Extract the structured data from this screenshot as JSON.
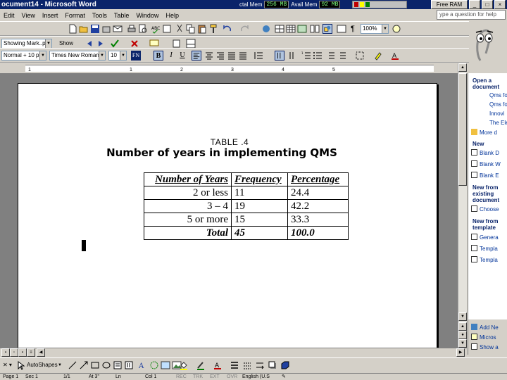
{
  "window": {
    "title": "ocument14 - Microsoft Word",
    "memory": {
      "total_label": "ctal Mem",
      "total_value": "256 MB",
      "avail_label": "Avail Mem",
      "avail_value": "92 MB"
    },
    "right_button": "Free RAM"
  },
  "menu": {
    "items": [
      "Edit",
      "View",
      "Insert",
      "Format",
      "Tools",
      "Table",
      "Window",
      "Help"
    ],
    "help_placeholder": "ype a question for help"
  },
  "toolbar_standard": {
    "zoom": "100%"
  },
  "toolbar_reviewing": {
    "display": "Showing Mark..p",
    "show": "Show"
  },
  "toolbar_formatting": {
    "style": "Normal + 10 pt",
    "font": "Times New Roman",
    "size": "10",
    "bold": "B",
    "italic": "I",
    "underline": "U"
  },
  "ruler_numbers": [
    "1",
    "1",
    "2",
    "3",
    "4",
    "5"
  ],
  "document": {
    "caption": "TABLE .4",
    "title": "Number of years in implementing QMS",
    "table": {
      "headers": [
        "Number of Years",
        "Frequency",
        "Percentage"
      ],
      "rows": [
        [
          "2 or less",
          "11",
          "24.4"
        ],
        [
          "3 – 4",
          "19",
          "42.2"
        ],
        [
          "5 or more",
          "15",
          "33.3"
        ]
      ],
      "total": [
        "Total",
        "45",
        "100.0"
      ]
    }
  },
  "task_pane": {
    "open_heading": "Open a document",
    "open_links": [
      "Qms fo",
      "Qms fo",
      "Innovi",
      "The Ele",
      "More d"
    ],
    "new_heading": "New",
    "new_links": [
      "Blank D",
      "Blank W",
      "Blank E"
    ],
    "existing_heading": "New from existing document",
    "existing_links": [
      "Choose"
    ],
    "template_heading": "New from template",
    "template_links": [
      "Genera",
      "Templa",
      "Templa"
    ],
    "bottom_links": [
      "Add Ne",
      "Micros",
      "Show a"
    ]
  },
  "drawing": {
    "autoshapes": "AutoShapes"
  },
  "status": {
    "page": "Page 1",
    "sec": "Sec 1",
    "pos": "1/1",
    "at": "At 3\"",
    "ln": "Ln",
    "col": "Col 1",
    "rec": "REC",
    "trk": "TRK",
    "ext": "EXT",
    "ovr": "OVR",
    "lang": "English (U.S"
  }
}
